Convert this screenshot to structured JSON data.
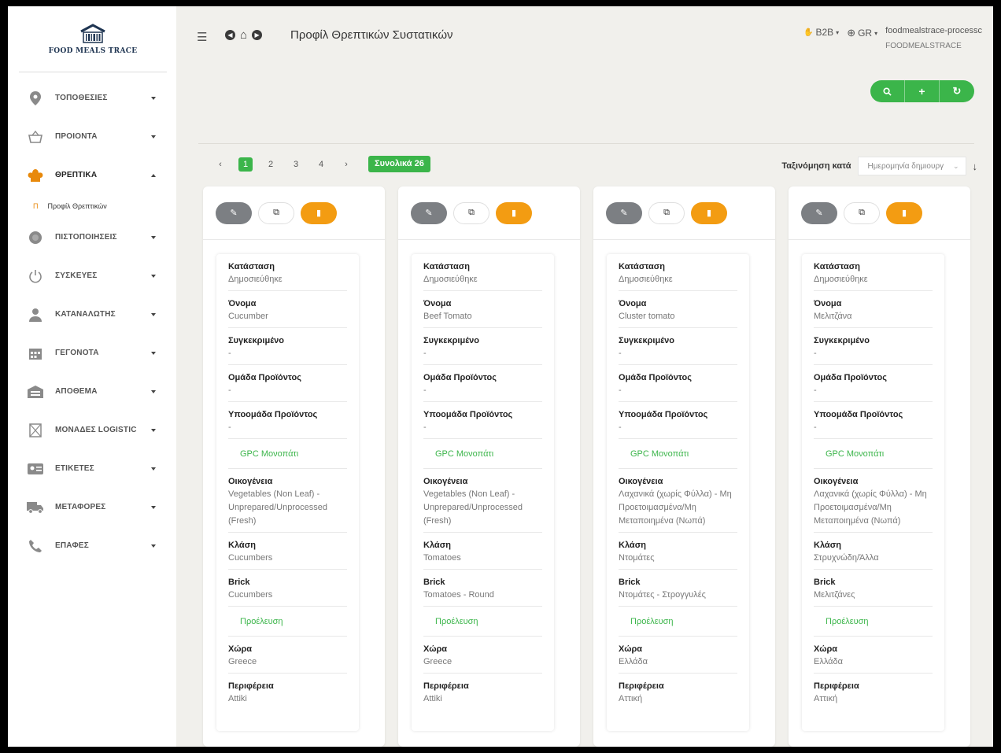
{
  "logo": {
    "text": "FOOD MEALS TRACE"
  },
  "sidebar": {
    "items": [
      {
        "label": "ΤΟΠΟΘΕΣΙΕΣ",
        "icon": "location-pin-icon",
        "expanded": false
      },
      {
        "label": "ΠΡΟΙΟΝΤΑ",
        "icon": "basket-icon",
        "expanded": false
      },
      {
        "label": "ΘΡΕΠΤΙΚΑ",
        "icon": "chef-hat-icon",
        "expanded": true,
        "sub": "Προφίλ Θρεπτικών",
        "sub_bullet": "Π"
      },
      {
        "label": "ΠΙΣΤΟΠΟΙΗΣΕΙΣ",
        "icon": "certificate-icon",
        "expanded": false
      },
      {
        "label": "ΣΥΣΚΕΥΕΣ",
        "icon": "power-icon",
        "expanded": false
      },
      {
        "label": "ΚΑΤΑΝΑΛΩΤΗΣ",
        "icon": "user-icon",
        "expanded": false
      },
      {
        "label": "ΓΕΓΟΝΟΤΑ",
        "icon": "calendar-icon",
        "expanded": false
      },
      {
        "label": "ΑΠΟΘΕΜΑ",
        "icon": "warehouse-icon",
        "expanded": false
      },
      {
        "label": "ΜΟΝΑΔΕΣ LOGISTIC",
        "icon": "box-icon",
        "expanded": false
      },
      {
        "label": "ΕΤΙΚΕΤΕΣ",
        "icon": "id-card-icon",
        "expanded": false
      },
      {
        "label": "ΜΕΤΑΦΟΡΕΣ",
        "icon": "truck-icon",
        "expanded": false
      },
      {
        "label": "ΕΠΑΦΕΣ",
        "icon": "phone-icon",
        "expanded": false
      }
    ]
  },
  "header": {
    "title": "Προφίλ Θρεπτικών Συστατικών",
    "b2b": "B2B",
    "lang": "GR",
    "user": "foodmealstrace-processc",
    "org": "FOODMEALSTRACE"
  },
  "pagination": {
    "pages": [
      "1",
      "2",
      "3",
      "4"
    ],
    "active": "1",
    "prev": "‹",
    "next": "›",
    "total": "Συνολικά 26"
  },
  "sort": {
    "label": "Ταξινόμηση κατά",
    "value": "Ημερομηνία δημιουργ",
    "arrow": "↓"
  },
  "labels": {
    "status": "Κατάσταση",
    "name": "Όνομα",
    "specific": "Συγκεκριμένο",
    "group": "Ομάδα Προϊόντος",
    "subgroup": "Υποομάδα Προϊόντος",
    "gpc": "GPC Μονοπάτι",
    "family": "Οικογένεια",
    "class": "Κλάση",
    "brick": "Brick",
    "origin": "Προέλευση",
    "country": "Χώρα",
    "region": "Περιφέρεια"
  },
  "cards": [
    {
      "status": "Δημοσιεύθηκε",
      "name": "Cucumber",
      "specific": "-",
      "group": "-",
      "subgroup": "-",
      "family": "Vegetables (Non Leaf) - Unprepared/Unprocessed (Fresh)",
      "class": "Cucumbers",
      "brick": "Cucumbers",
      "country": "Greece",
      "region": "Attiki"
    },
    {
      "status": "Δημοσιεύθηκε",
      "name": "Beef Tomato",
      "specific": "-",
      "group": "-",
      "subgroup": "-",
      "family": "Vegetables (Non Leaf) - Unprepared/Unprocessed (Fresh)",
      "class": "Tomatoes",
      "brick": "Tomatoes - Round",
      "country": "Greece",
      "region": "Attiki"
    },
    {
      "status": "Δημοσιεύθηκε",
      "name": "Cluster tomato",
      "specific": "-",
      "group": "-",
      "subgroup": "-",
      "family": "Λαχανικά (χωρίς Φύλλα) - Μη Προετοιμασμένα/Μη Μεταποιημένα (Νωπά)",
      "class": "Ντομάτες",
      "brick": "Ντομάτες - Στρογγυλές",
      "country": "Ελλάδα",
      "region": "Αττική"
    },
    {
      "status": "Δημοσιεύθηκε",
      "name": "Μελιτζάνα",
      "specific": "-",
      "group": "-",
      "subgroup": "-",
      "family": "Λαχανικά (χωρίς Φύλλα) - Μη Προετοιμασμένα/Μη Μεταποιημένα (Νωπά)",
      "class": "Στρυχνώδη/Άλλα",
      "brick": "Μελιτζάνες",
      "country": "Ελλάδα",
      "region": "Αττική"
    }
  ],
  "colors": {
    "accent": "#3bb54a",
    "delete": "#f39c12",
    "edit": "#7c7f83",
    "sidebar_icon": "#8a8a8a",
    "chef_hat": "#e8890b"
  }
}
